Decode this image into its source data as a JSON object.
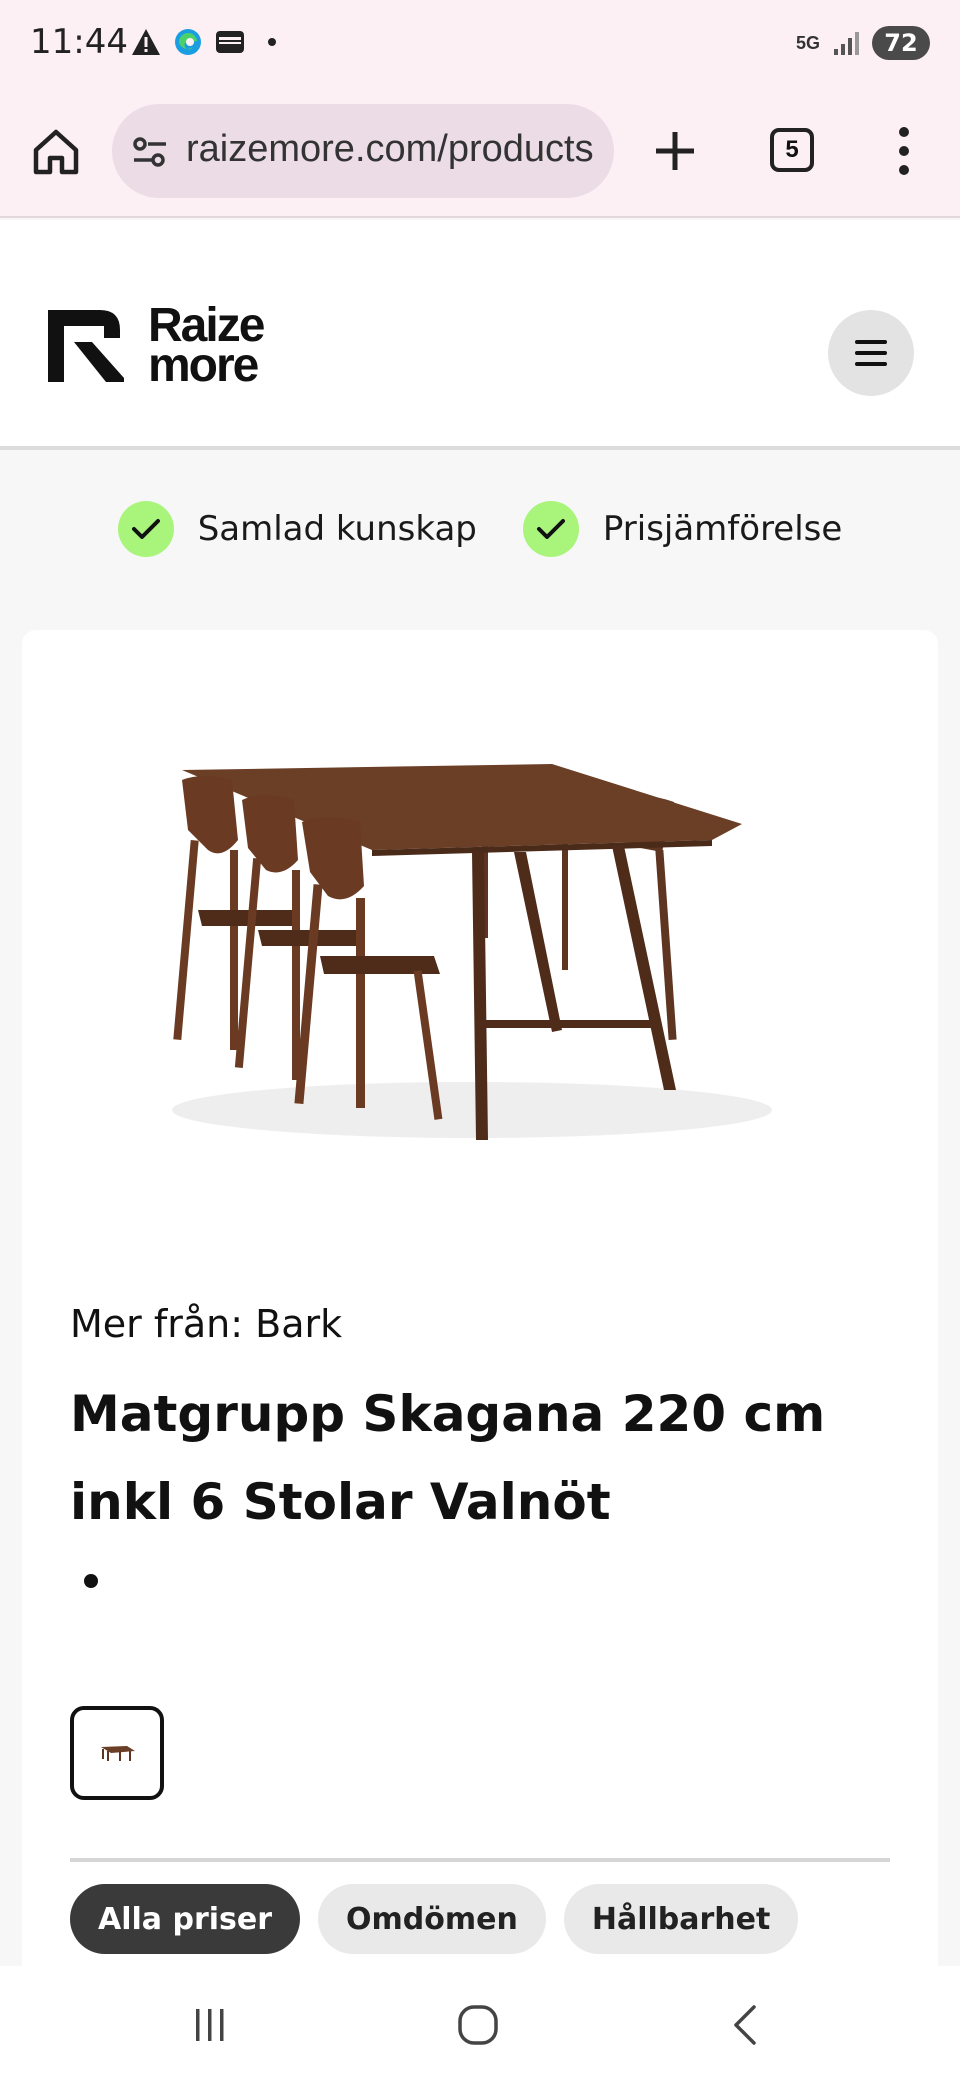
{
  "status": {
    "time": "11:44",
    "network": "5G",
    "battery": "72",
    "icons": [
      "warning-icon",
      "edge-icon",
      "wallet-icon",
      "dot-icon",
      "signal-icon"
    ]
  },
  "browser": {
    "url": "raizemore.com/products",
    "tab_count": "5"
  },
  "site": {
    "logo_line1": "Raize",
    "logo_line2": "more"
  },
  "usps": [
    {
      "label": "Samlad kunskap"
    },
    {
      "label": "Prisjämförelse"
    }
  ],
  "product": {
    "brand_line": "Mer från: Bark",
    "title": "Matgrupp Skagana 220 cm inkl 6 Stolar Valnöt",
    "image_subject": "walnut dining table with six chairs"
  },
  "tabs": [
    {
      "label": "Alla priser",
      "active": true
    },
    {
      "label": "Omdömen",
      "active": false
    },
    {
      "label": "Hållbarhet",
      "active": false
    }
  ],
  "colors": {
    "chrome_bg": "#fcf0f4",
    "url_bg": "#ecdce6",
    "check_green": "#a9f57c",
    "active_pill": "#3a3a3a",
    "wood": "#6b3e26"
  }
}
